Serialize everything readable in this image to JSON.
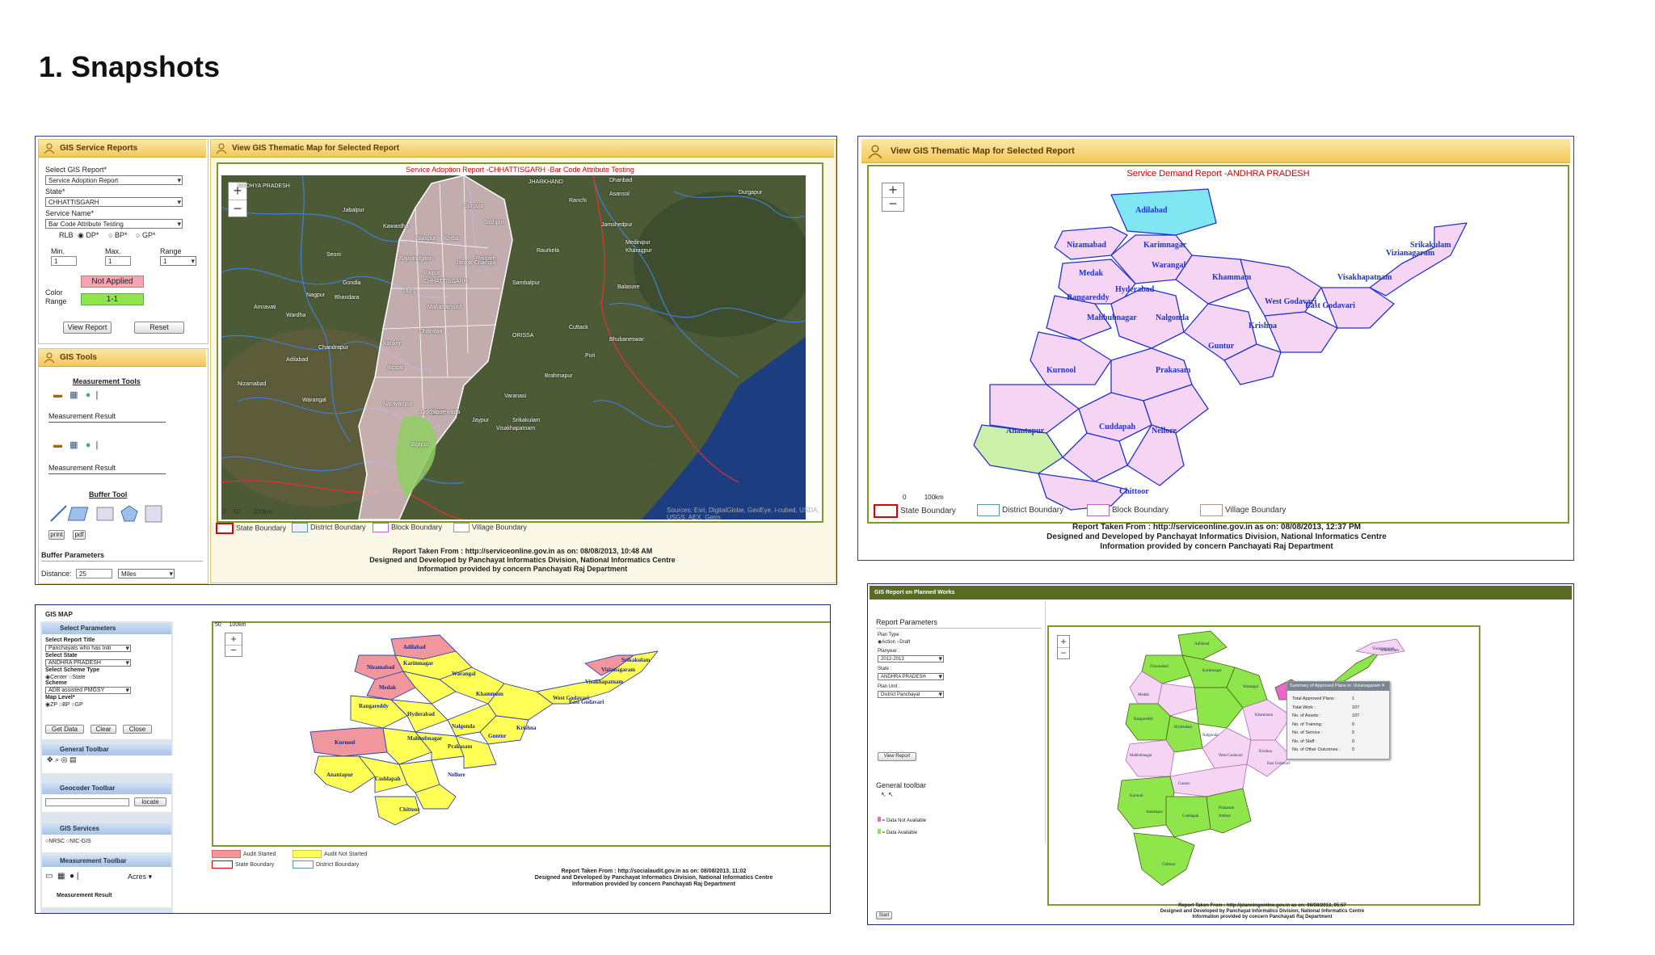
{
  "heading": "1. Snapshots",
  "s1": {
    "left_head": "GIS Service Reports",
    "select_report_label": "Select GIS Report*",
    "select_report_value": "Service Adoption Report",
    "state_label": "State*",
    "state_value": "CHHATTISGARH",
    "service_label": "Service Name*",
    "service_value": "Bar Code Attribute Testing",
    "rlb_label": "RLB",
    "rlb_options": [
      "DP*",
      "BP*",
      "GP*"
    ],
    "min_label": "Min.",
    "min_value": "1",
    "max_label": "Max.",
    "max_value": "1",
    "range_label": "Range",
    "range_value": "1",
    "not_applied": "Not Applied",
    "color_label": "Color",
    "range_label2": "Range",
    "color_range_value": "1-1",
    "view_report": "View Report",
    "reset": "Reset",
    "tools_head": "GIS Tools",
    "measurement_tools": "Measurement Tools",
    "measurement_result_1": "Measurement Result",
    "measurement_result_2": "Measurement Result",
    "buffer_tool": "Buffer Tool",
    "print": "print",
    "pdf": "pdf",
    "buffer_params": "Buffer Parameters",
    "distance_label": "Distance:",
    "distance_value": "25",
    "distance_unit": "Miles",
    "map_head": "View GIS Thematic Map for Selected Report",
    "map_title": "Service Adoption Report -CHHATTISGARH -Bar Code Attribute Testing",
    "scale_0": "0",
    "scale_50": "50",
    "scale_100": "100km",
    "legend": [
      "State Boundary",
      "District Boundary",
      "Block Boundary",
      "Village Boundary"
    ],
    "attribution": "Sources: Esri, DigitalGlobe, GeoEye, i-cubed, USDA, USGS, AEX, Getm",
    "map_labels": [
      "MADHYA PRADESH",
      "JHARKHAND",
      "Dhanbad",
      "Asansol",
      "Durgapur",
      "Ranchi",
      "Jamshedpur",
      "Jabalpur",
      "Seoni",
      "Nagpur",
      "Bhandara",
      "Gondia",
      "Amravati",
      "Wardha",
      "Chandrapur",
      "Adilabad",
      "Nizamabad",
      "Warangal",
      "Raipur",
      "Durg",
      "Bilaspur",
      "Korba",
      "Surguja",
      "Jashpur",
      "Raigarh",
      "Janjgir-Champa",
      "Mahasamund",
      "Dhamtari",
      "Kanker",
      "Bastar",
      "Narayanpur",
      "Dantewada",
      "Bijapur",
      "Jagdalpur",
      "Jaypur",
      "Sambalpur",
      "Bhubaneswar",
      "Cuttack",
      "ORISSA",
      "Brahmapur",
      "Srikakulam",
      "Visakhapatnam",
      "Varanasi",
      "Balasore",
      "Kharagpur",
      "Medinipur",
      "Raurkela",
      "Puri",
      "Rajnandgaon",
      "Kawardha",
      "CHHATTISGARH"
    ],
    "footer": [
      "Report Taken From : http://serviceonline.gov.in as on: 08/08/2013, 10:48 AM",
      "Designed and Developed by Panchayat Informatics Division, National Informatics Centre",
      "Information provided by concern Panchayati Raj Department"
    ]
  },
  "s2": {
    "map_head": "View GIS Thematic Map for Selected Report",
    "map_title": "Service Demand Report -ANDHRA PRADESH",
    "scale_0": "0",
    "scale_100": "100km",
    "legend": [
      "State Boundary",
      "District Boundary",
      "Block Boundary",
      "Village Boundary"
    ],
    "districts": [
      "Adilabad",
      "Nizamabad",
      "Karimnagar",
      "Warangal",
      "Medak",
      "Khammam",
      "Rangareddy",
      "Hyderabad",
      "Nalgonda",
      "Mahbubnagar",
      "Krishna",
      "West Godavari",
      "East Godavari",
      "Visakhapatnam",
      "Vizianagaram",
      "Srikakulam",
      "Guntur",
      "Kurnool",
      "Prakasam",
      "Anantapur",
      "Cuddapah",
      "Nellore",
      "Chittoor"
    ],
    "footer": [
      "Report Taken From : http://serviceonline.gov.in as on: 08/08/2013, 12:37 PM",
      "Designed and Developed by Panchayat Informatics Division, National Informatics Centre",
      "Information provided by concern Panchayati Raj Department"
    ]
  },
  "s3": {
    "title": "GIS MAP",
    "select_params": "Select Parameters",
    "report_title_label": "Select Report Title",
    "report_title_value": "Panchayats who has Initi",
    "state_label": "Select State",
    "state_value": "ANDHRA PRADESH",
    "scheme_type_label": "Select Scheme Type",
    "scheme_type_options": [
      "Center",
      "State"
    ],
    "scheme_label": "Scheme",
    "scheme_value": "ADB assisted PMGSY",
    "map_level_label": "Map Level*",
    "map_level_options": [
      "ZP",
      "BP",
      "GP"
    ],
    "get_data": "Get Data",
    "clear": "Clear",
    "close": "Close",
    "general_toolbar": "General Toolbar",
    "geocoder_toolbar": "Geocoder Toolbar",
    "locate": "locate",
    "gis_services": "GIS Services",
    "services_options": [
      "NRSC",
      "NIC-GIS"
    ],
    "measurement_toolbar": "Measurement Toolbar",
    "acres": "Acres",
    "measurement_result": "Measurement Result",
    "scale_50": "50",
    "scale_100": "100km",
    "legend": [
      "Audit Started",
      "Audit Not Started",
      "State Boundary",
      "District Boundary"
    ],
    "footer": [
      "Report Taken From : http://socialaudit.gov.in as on: 08/08/2013, 11:02",
      "Designed and Developed by Panchayat Informatics Division, National Informatics Centre",
      "Information provided by concern Panchayati Raj Department"
    ]
  },
  "s4": {
    "title": "GIS Report on Planned Works",
    "report_params": "Report Parameters",
    "plan_type_label": "Plan Type :",
    "plan_type_options": [
      "Action",
      "Draft"
    ],
    "planyear_label": "Planyear :",
    "planyear_value": "2012-2013",
    "state_label": "State :",
    "state_value": "ANDHRA PRADESH",
    "plan_unit_label": "Plan Unit :",
    "plan_unit_value": "District Panchayat",
    "view_report": "View Report",
    "general_toolbar": "General toolbar",
    "data_not_available": "= Data Not Available",
    "data_available": "= Data Available",
    "start": "Start",
    "popup_title": "Summary of Approved Plans in: Vizianagaram",
    "popup_rows": [
      {
        "k": "Total Approved Plans :",
        "v": "1"
      },
      {
        "k": "Total Work :",
        "v": "107"
      },
      {
        "k": "No. of Assets :",
        "v": "107"
      },
      {
        "k": "No. of Training :",
        "v": "0"
      },
      {
        "k": "No. of Service :",
        "v": "0"
      },
      {
        "k": "No. of Staff :",
        "v": "0"
      },
      {
        "k": "No. of Other Outcomes :",
        "v": "0"
      }
    ],
    "footer": [
      "Report Taken From : http://planningonline.gov.in as on: 08/08/2013, 05:57",
      "Designed and Developed by Panchayat Informatics Division, National Informatics Centre",
      "Information provided by concern Panchayati Raj Department"
    ]
  },
  "colors": {
    "panel_border": "#2a3f8f",
    "pink": "#f5d5f3",
    "cyan": "#7fe6f2",
    "lightgreen": "#ccf0a8",
    "yellow": "#ffff55",
    "salmon": "#f0969c",
    "green": "#8ee64b",
    "olive": "#7b8f2b"
  }
}
